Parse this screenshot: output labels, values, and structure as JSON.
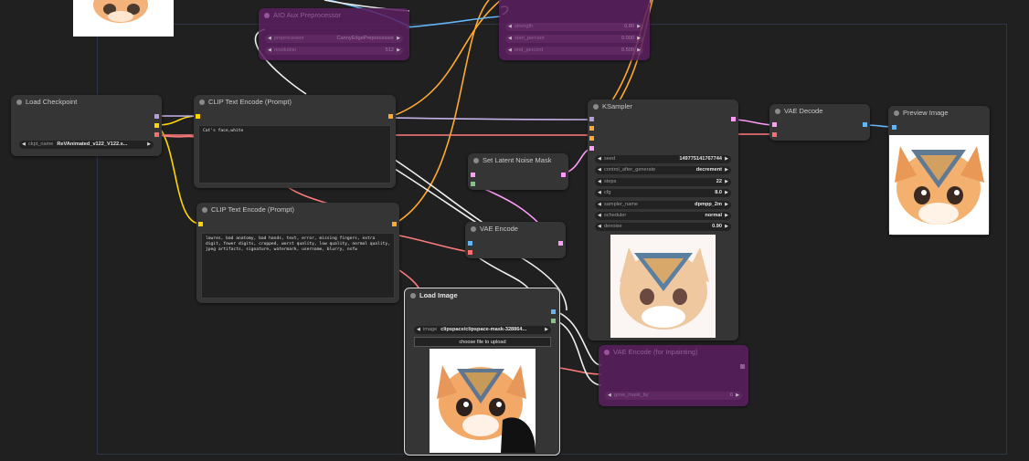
{
  "nodes": {
    "aio_preprocessor": {
      "title": "AIO Aux Preprocessor",
      "preprocessor_label": "preprocessor",
      "preprocessor_value": "CannyEdgePreprocessor",
      "resolution_label": "resolution",
      "resolution_value": "512"
    },
    "controlnet": {
      "strength_label": "strength",
      "strength_value": "0.80",
      "start_percent_label": "start_percent",
      "start_percent_value": "0.000",
      "end_percent_label": "end_percent",
      "end_percent_value": "0.500"
    },
    "load_checkpoint": {
      "title": "Load Checkpoint",
      "ckpt_label": "ckpt_name",
      "ckpt_value": "ReVAnimated_v122_V122.s..."
    },
    "clip_positive": {
      "title": "CLIP Text Encode (Prompt)",
      "text": "Cat's face,white"
    },
    "clip_negative": {
      "title": "CLIP Text Encode (Prompt)",
      "text": "lowres, bad anatomy, bad hands, text, error, missing fingers, extra digit, fewer digits, cropped, worst quality, low quality, normal quality, jpeg artifacts, signature, watermark, username, blurry, nsfw"
    },
    "set_latent_mask": {
      "title": "Set Latent Noise Mask"
    },
    "vae_encode": {
      "title": "VAE Encode"
    },
    "load_image": {
      "title": "Load Image",
      "image_label": "image",
      "image_value": "clipspace/clipspace-mask-328864...",
      "upload_label": "choose file to upload"
    },
    "ksampler": {
      "title": "KSampler",
      "widgets": [
        {
          "label": "seed",
          "value": "149775141767744"
        },
        {
          "label": "control_after_generate",
          "value": "decrement"
        },
        {
          "label": "steps",
          "value": "22"
        },
        {
          "label": "cfg",
          "value": "8.0"
        },
        {
          "label": "sampler_name",
          "value": "dpmpp_2m"
        },
        {
          "label": "scheduler",
          "value": "normal"
        },
        {
          "label": "denoise",
          "value": "0.90"
        }
      ]
    },
    "vae_encode_inpaint": {
      "title": "VAE Encode (for Inpainting)",
      "grow_label": "grow_mask_by",
      "grow_value": "6"
    },
    "vae_decode": {
      "title": "VAE Decode"
    },
    "preview_image": {
      "title": "Preview Image"
    }
  },
  "colors": {
    "model": "#b39ddb",
    "clip": "#ffd500",
    "vae": "#ff6e6e",
    "conditioning": "#ffa931",
    "latent": "#ff9cf9",
    "image": "#64b5f6",
    "mask": "#81c784",
    "bypass": "#5a1f5f"
  }
}
